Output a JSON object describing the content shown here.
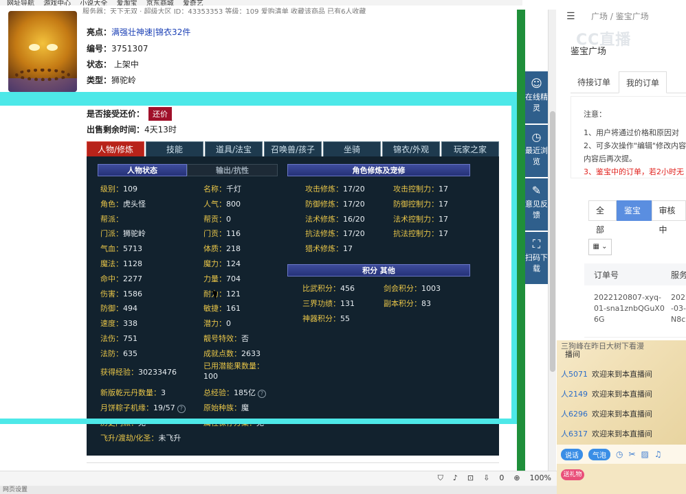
{
  "bookmarks": [
    "网址导航",
    "游戏中心",
    "小说大全",
    "爱淘宝",
    "京东商城",
    "爱奇艺"
  ],
  "page_topline": "服务器：天下无双 · 超级大区     ID：43353353     等级：109       爱购清单        收藏该商品       已有6人收藏",
  "item": {
    "highlight_label": "亮点：",
    "highlight_value": "满强壮神速|锦衣32件",
    "id_label": "编号：",
    "id_value": "3751307",
    "status_label": "状态：",
    "status_value": "上架中",
    "type_label": "类型：",
    "type_value": "狮驼岭",
    "bargain_label": "是否接受还价：",
    "bargain_button": "还价",
    "remaining_label": "出售剩余时间：",
    "remaining_value": "4天13时"
  },
  "tabs": [
    "人物/修炼",
    "技能",
    "道具/法宝",
    "召唤兽/孩子",
    "坐骑",
    "锦衣/外观",
    "玩家之家"
  ],
  "subheads": {
    "char_status": "人物状态",
    "output_resist": "输出/抗性",
    "cultivation": "角色修炼及宠修",
    "points": "积分  其他"
  },
  "char_col1": [
    {
      "k": "级别：",
      "v": "109"
    },
    {
      "k": "角色：",
      "v": "虎头怪"
    },
    {
      "k": "帮派：",
      "v": ""
    },
    {
      "k": "门派：",
      "v": "狮驼岭"
    },
    {
      "k": "气血：",
      "v": "5713"
    },
    {
      "k": "魔法：",
      "v": "1128"
    },
    {
      "k": "命中：",
      "v": "2277"
    },
    {
      "k": "伤害：",
      "v": "1586"
    },
    {
      "k": "防御：",
      "v": "494"
    },
    {
      "k": "速度：",
      "v": "338"
    },
    {
      "k": "法伤：",
      "v": "751"
    },
    {
      "k": "法防：",
      "v": "635"
    }
  ],
  "char_col2": [
    {
      "k": "名称：",
      "v": "千灯"
    },
    {
      "k": "人气：",
      "v": "800"
    },
    {
      "k": "帮贡：",
      "v": "0"
    },
    {
      "k": "门贡：",
      "v": "116"
    },
    {
      "k": "体质：",
      "v": "218"
    },
    {
      "k": "魔力：",
      "v": "124"
    },
    {
      "k": "力量：",
      "v": "704"
    },
    {
      "k": "耐力：",
      "v": "121"
    },
    {
      "k": "敏捷：",
      "v": "161"
    },
    {
      "k": "潜力：",
      "v": "0"
    },
    {
      "k": "靓号特效：",
      "v": "否"
    },
    {
      "k": "成就点数：",
      "v": "2633"
    }
  ],
  "extra": {
    "exp_label": "获得经验：",
    "exp_value": "30233476",
    "fruit_label": "已用潜能果数量：",
    "fruit_value": "100",
    "qianyuan_label": "新版乾元丹数量：",
    "qianyuan_value": "3",
    "total_exp_label": "总经验：",
    "total_exp_value": "185亿",
    "zongzi_label": "月饼粽子机缘：",
    "zongzi_value": "19/57",
    "race_label": "原始种族：",
    "race_value": "魔",
    "history_label": "历史门派：",
    "history_value": "无",
    "attr_label": "属性保存方案：",
    "attr_value": "无",
    "fly_label": "飞升/渡劫/化圣：",
    "fly_value": "未飞升"
  },
  "cultivation": [
    {
      "k": "攻击修炼：",
      "v": "17/20",
      "k2": "攻击控制力：",
      "v2": "17"
    },
    {
      "k": "防御修炼：",
      "v": "17/20",
      "k2": "防御控制力：",
      "v2": "17"
    },
    {
      "k": "法术修炼：",
      "v": "16/20",
      "k2": "法术控制力：",
      "v2": "17"
    },
    {
      "k": "抗法修炼：",
      "v": "17/20",
      "k2": "抗法控制力：",
      "v2": "17"
    },
    {
      "k": "猎术修炼：",
      "v": "17",
      "k2": "",
      "v2": ""
    }
  ],
  "points": [
    {
      "k": "比武积分：",
      "v": "456",
      "k2": "剑会积分：",
      "v2": "1003"
    },
    {
      "k": "三界功绩：",
      "v": "131",
      "k2": "副本积分：",
      "v2": "83"
    },
    {
      "k": "神器积分：",
      "v": "55",
      "k2": "",
      "v2": ""
    }
  ],
  "side_tools": [
    {
      "icon": "mascot-icon",
      "label": "在线精灵"
    },
    {
      "icon": "clock-icon",
      "label": "最近浏览"
    },
    {
      "icon": "edit-icon",
      "label": "意见反馈"
    },
    {
      "icon": "scan-icon",
      "label": "扫码下载"
    }
  ],
  "right": {
    "breadcrumb_1": "广场",
    "breadcrumb_sep": "/",
    "breadcrumb_2": "鉴宝广场",
    "watermark": "CC直播",
    "section_title": "鉴宝广场",
    "order_tab_1": "待接订单",
    "order_tab_2": "我的订单",
    "notice_title": "注意：",
    "notice_1": "1、用户将通过价格和原因对",
    "notice_2": "2、可多次操作\"编辑\"修改内容",
    "notice_3": "内容后再次提。",
    "notice_4": "3、鉴宝中的订单，若2小时无",
    "filter_all": "全部",
    "filter_active": "鉴宝中",
    "filter_review": "审核中",
    "table_col1": "订单号",
    "table_col2": "服务",
    "row_order": "2022120807-xyq-01-sna1znbQGuX06G",
    "row_service": "2022-03-N8c"
  },
  "chat": [
    {
      "user": "",
      "text": "播间"
    },
    {
      "user": "人5071",
      "text": "欢迎来到本直播间"
    },
    {
      "user": "人2149",
      "text": "欢迎来到本直播间"
    },
    {
      "user": "人6296",
      "text": "欢迎来到本直播间"
    },
    {
      "user": "人6317",
      "text": "欢迎来到本直播间"
    }
  ],
  "chat_top_text": "三狗峰在昨日大树下看漫",
  "chat_tools": {
    "pill1": "说话",
    "pill2": "气泡",
    "gift": "送礼物"
  },
  "status": {
    "zoom": "100%",
    "count": "0"
  },
  "status_bottom": "网页设置"
}
